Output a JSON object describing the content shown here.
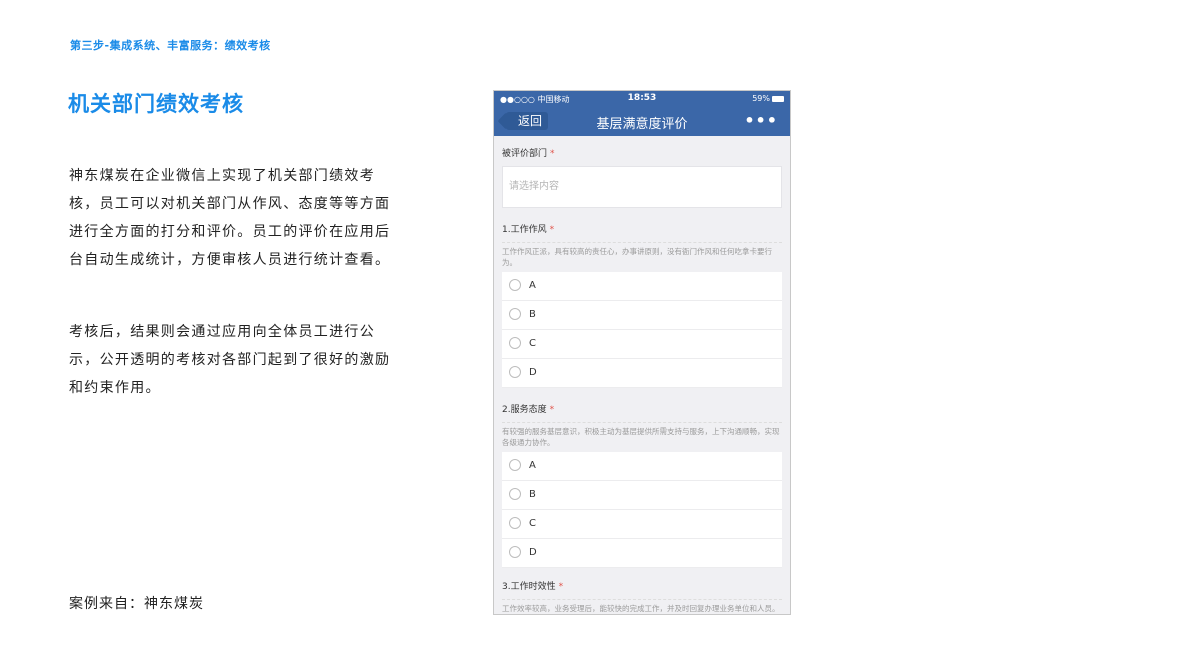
{
  "header": {
    "step": "第三步-集成系统、丰富服务：绩效考核",
    "title": "机关部门绩效考核"
  },
  "body": {
    "paragraph1": "神东煤炭在企业微信上实现了机关部门绩效考核，员工可以对机关部门从作风、态度等等方面进行全方面的打分和评价。员工的评价在应用后台自动生成统计，方便审核人员进行统计查看。",
    "paragraph2": "考核后，结果则会通过应用向全体员工进行公示，公开透明的考核对各部门起到了很好的激励和约束作用。",
    "source": "案例来自：神东煤炭"
  },
  "phone": {
    "status": {
      "carrier": "●●○○○ 中国移动",
      "time": "18:53",
      "battery": "59%"
    },
    "nav": {
      "back": "返回",
      "title": "基层满意度评价",
      "more": "•••"
    },
    "form": {
      "dept_label": "被评价部门",
      "required_mark": "*",
      "dept_placeholder": "请选择内容",
      "questions": [
        {
          "label": "1.工作作风",
          "desc": "工作作风正派，具有较高的责任心，办事讲原则，没有衙门作风和任何吃拿卡要行为。",
          "options": [
            "A",
            "B",
            "C",
            "D"
          ]
        },
        {
          "label": "2.服务态度",
          "desc": "有较强的服务基层意识，积极主动为基层提供所需支持与服务，上下沟通顺畅，实现各级通力协作。",
          "options": [
            "A",
            "B",
            "C",
            "D"
          ]
        },
        {
          "label": "3.工作时效性",
          "desc": "工作效率较高，业务受理后，能较快的完成工作，并及时回复办理业务单位和人员。"
        }
      ]
    }
  }
}
